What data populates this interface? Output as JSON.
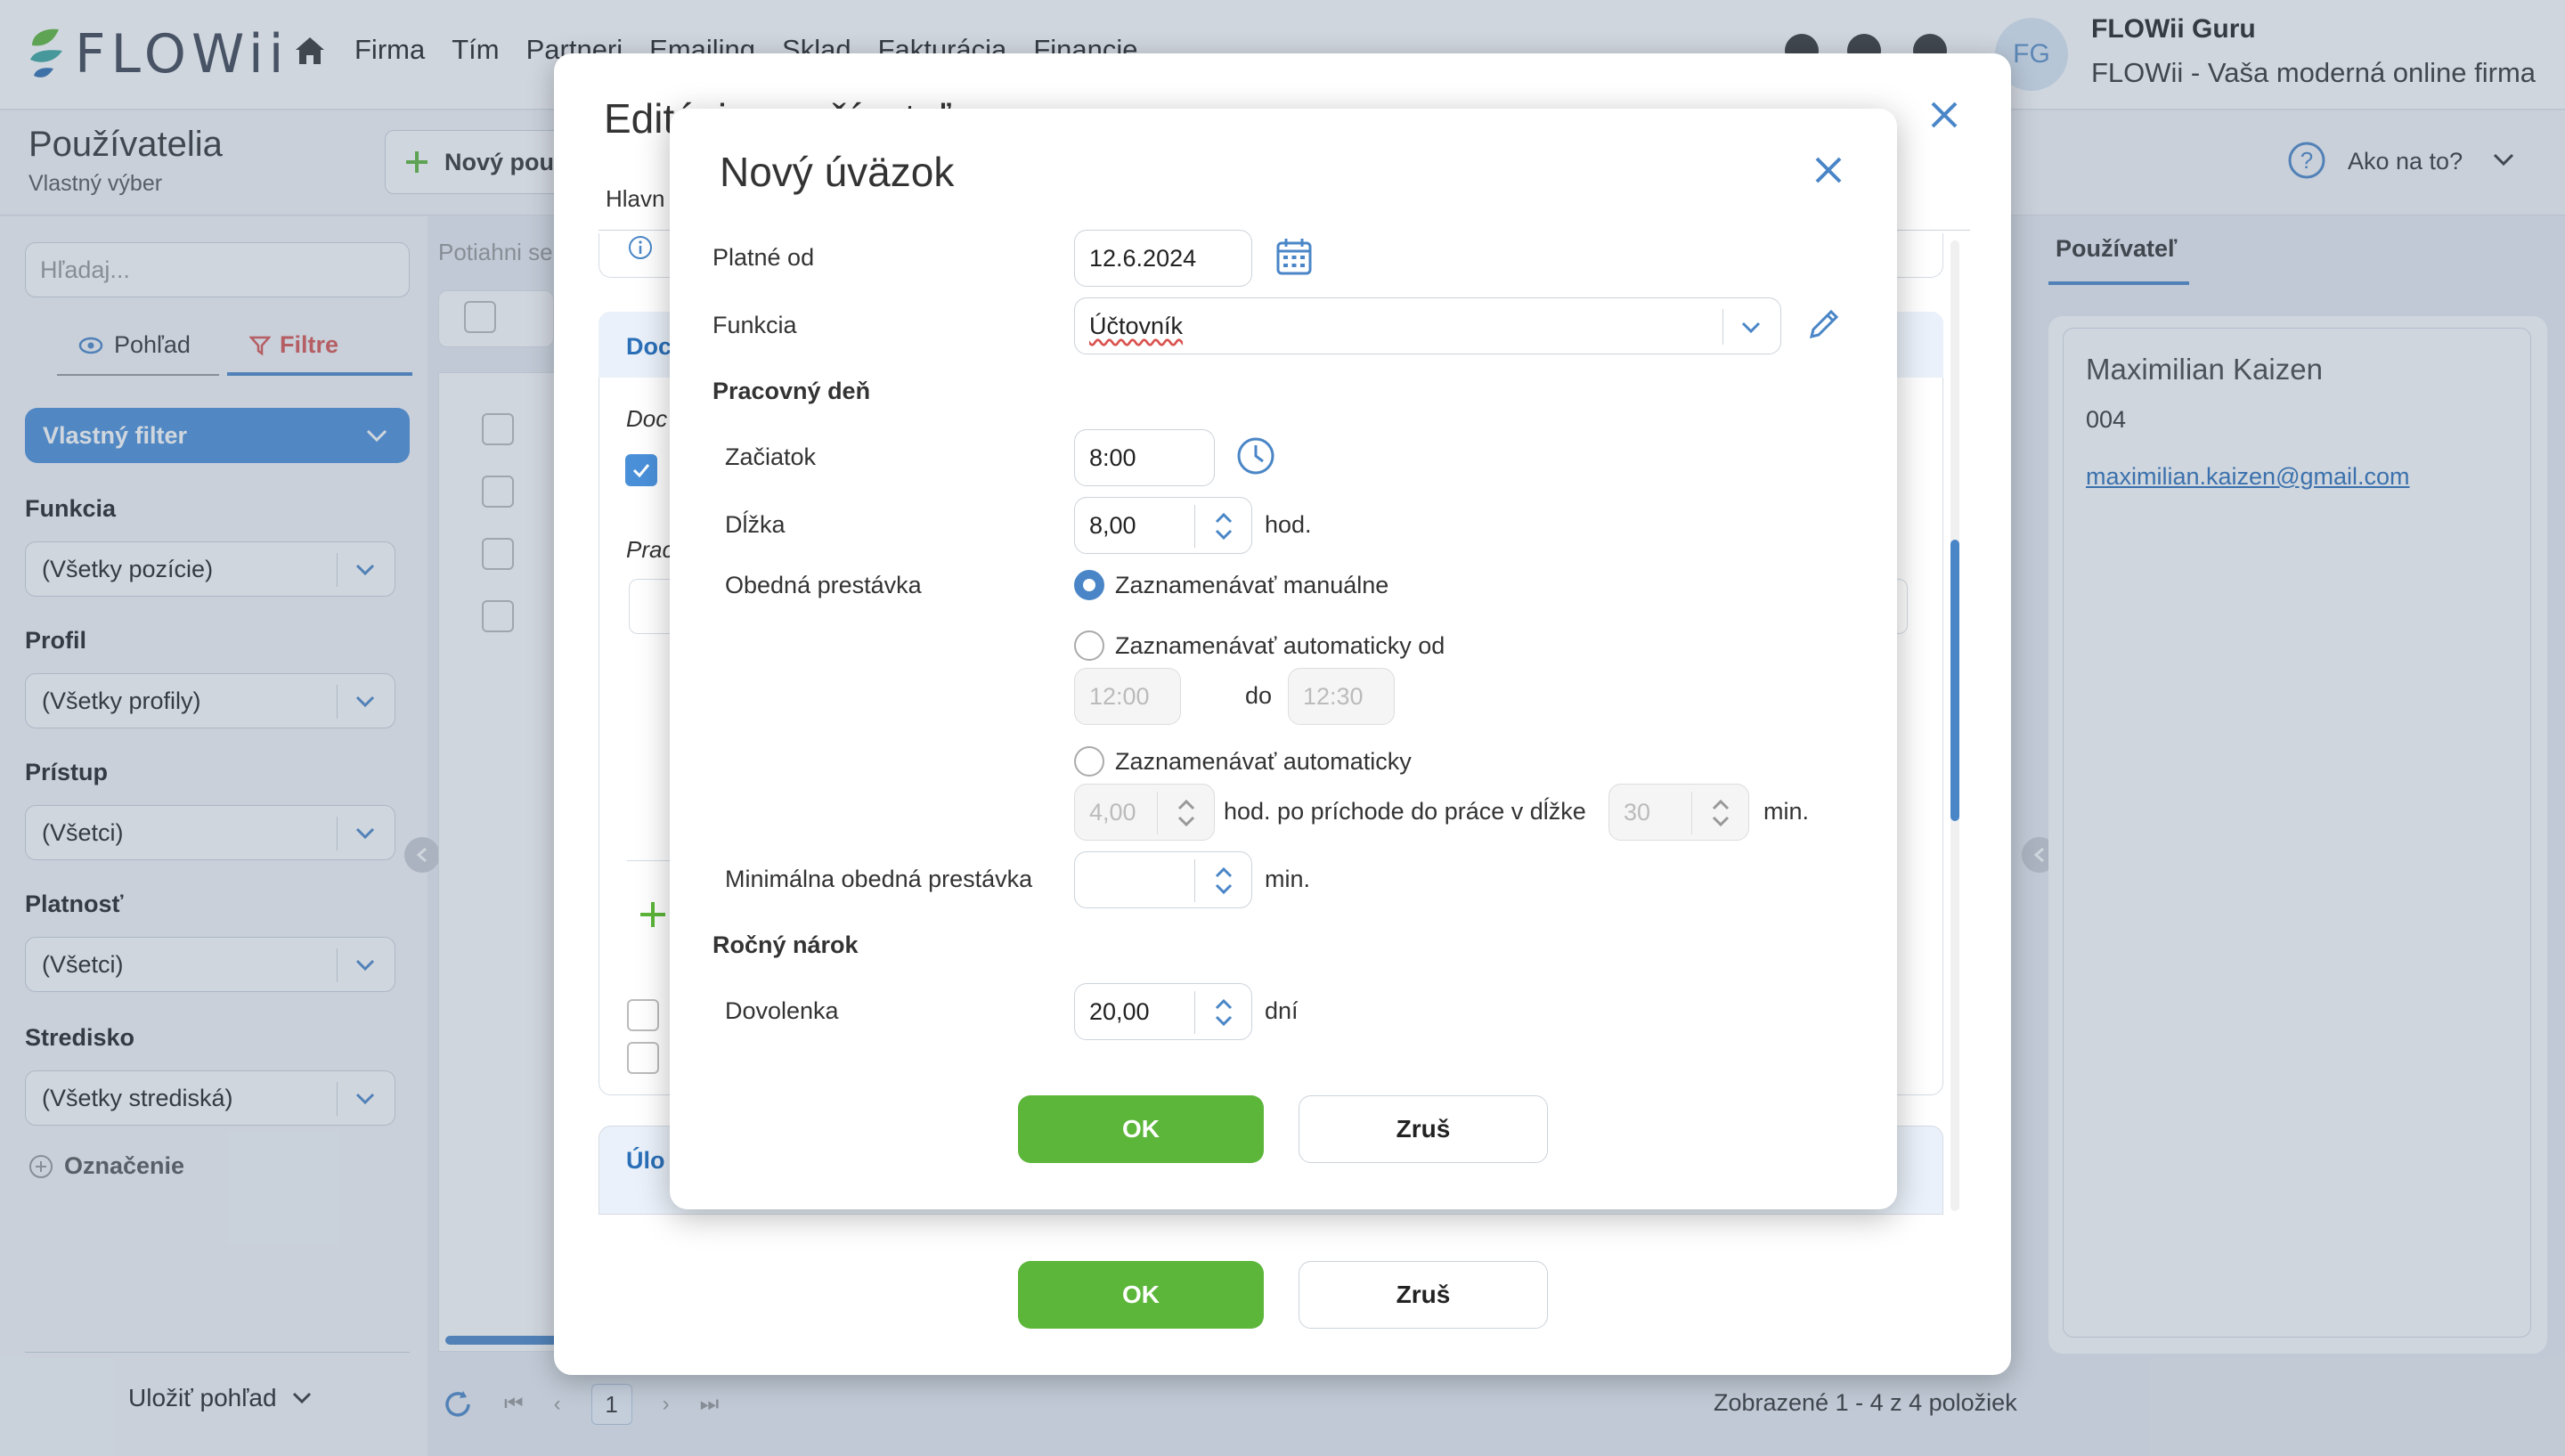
{
  "app": {
    "logo_text": "FLOWii",
    "menu": [
      "Firma",
      "Tím",
      "Partneri",
      "Emailing",
      "Sklad",
      "Fakturácia",
      "Financie"
    ],
    "user_initials": "FG",
    "user_name": "FLOWii Guru",
    "user_company": "FLOWii - Vaša moderná online firma"
  },
  "page": {
    "title": "Používatelia",
    "subtitle": "Vlastný výber",
    "new_user_button": "Nový pou",
    "help_label": "Ako na to?"
  },
  "left_panel": {
    "search_placeholder": "Hľadaj...",
    "view_tab": "Pohľad",
    "filter_tab": "Filtre",
    "custom_filter": "Vlastný filter",
    "filters": [
      {
        "label": "Funkcia",
        "value": "(Všetky pozície)"
      },
      {
        "label": "Profil",
        "value": "(Všetky profily)"
      },
      {
        "label": "Prístup",
        "value": "(Všetci)"
      },
      {
        "label": "Platnosť",
        "value": "(Všetci)"
      },
      {
        "label": "Stredisko",
        "value": "(Všetky strediská)"
      }
    ],
    "mark_link": "Označenie",
    "save_view": "Uložiť pohľad"
  },
  "center_panel": {
    "drop_hint": "Potiahni se",
    "page_number": "1",
    "items_count": "Zobrazené 1 - 4 z 4 položiek"
  },
  "right_panel": {
    "tab": "Používateľ",
    "name": "Maximilian Kaizen",
    "id": "004",
    "email": "maximilian.kaizen@gmail.com"
  },
  "outer_modal": {
    "title": "Editácia používateľa",
    "tab": "Hlavn",
    "section1_title": "Doc",
    "doc_label": "Doc",
    "prac_label": "Prac",
    "section2_title": "Úlo",
    "ok": "OK",
    "cancel": "Zruš"
  },
  "inner_modal": {
    "title": "Nový úväzok",
    "valid_from_label": "Platné od",
    "valid_from": "12.6.2024",
    "function_label": "Funkcia",
    "function_value": "Účtovník",
    "workday_section": "Pracovný deň",
    "start_label": "Začiatok",
    "start_value": "8:00",
    "length_label": "Dĺžka",
    "length_value": "8,00",
    "length_unit": "hod.",
    "lunch_label": "Obedná prestávka",
    "lunch_options": [
      {
        "label": "Zaznamenávať manuálne",
        "selected": true
      },
      {
        "label": "Zaznamenávať automaticky od",
        "selected": false
      },
      {
        "label": "Zaznamenávať automaticky",
        "selected": false
      }
    ],
    "auto_from": "12:00",
    "auto_to_label": "do",
    "auto_to": "12:30",
    "auto_hours": "4,00",
    "auto_hours_text": "hod. po príchode do práce v dĺžke",
    "auto_minutes": "30",
    "min_unit": "min.",
    "min_lunch_label": "Minimálna obedná prestávka",
    "min_lunch_value": "",
    "annual_section": "Ročný nárok",
    "vacation_label": "Dovolenka",
    "vacation_value": "20,00",
    "vacation_unit": "dní",
    "ok": "OK",
    "cancel": "Zruš"
  },
  "colors": {
    "accent": "#4a86c7",
    "ok_green": "#5cb63a",
    "filter_red": "#d9534f"
  }
}
